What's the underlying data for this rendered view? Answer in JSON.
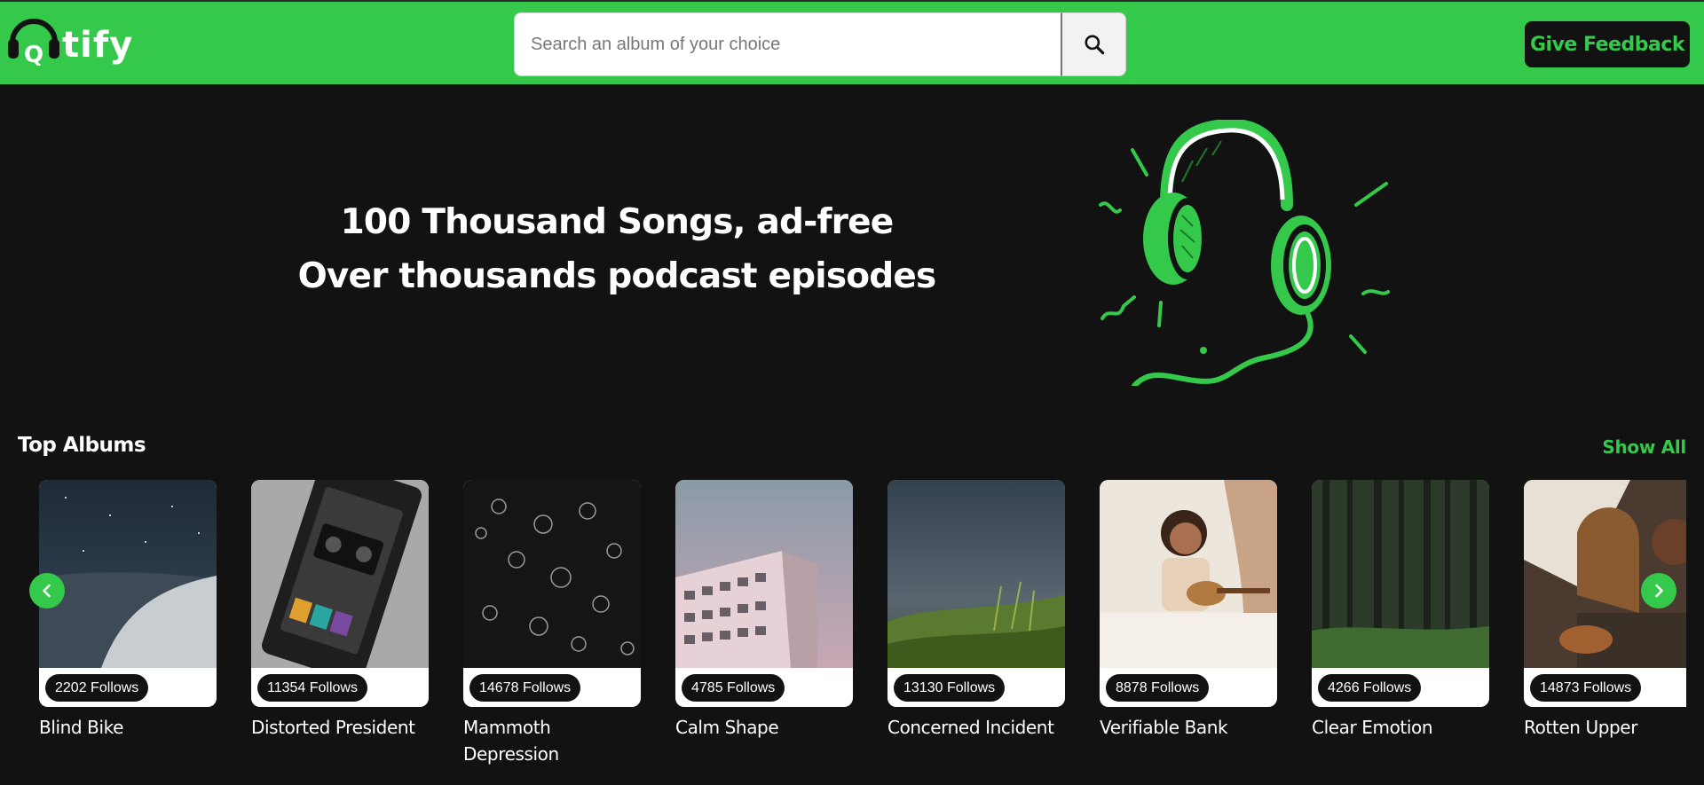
{
  "navbar": {
    "logo_text": "tify",
    "logo_letter": "Q",
    "search_placeholder": "Search an album of your choice",
    "search_icon": "search-icon",
    "feedback_label": "Give Feedback",
    "brand_color": "#34c94b"
  },
  "hero": {
    "line1": "100 Thousand Songs, ad-free",
    "line2": "Over thousands podcast episodes",
    "art_icon": "headphones-illustration"
  },
  "top_albums": {
    "title": "Top Albums",
    "show_all": "Show All",
    "prev_icon": "chevron-left-icon",
    "next_icon": "chevron-right-icon",
    "albums": [
      {
        "name": "Blind Bike",
        "follows": "2202 Follows"
      },
      {
        "name": "Distorted President",
        "follows": "11354 Follows"
      },
      {
        "name": "Mammoth Depression",
        "follows": "14678 Follows"
      },
      {
        "name": "Calm Shape",
        "follows": "4785 Follows"
      },
      {
        "name": "Concerned Incident",
        "follows": "13130 Follows"
      },
      {
        "name": "Verifiable Bank",
        "follows": "8878 Follows"
      },
      {
        "name": "Clear Emotion",
        "follows": "4266 Follows"
      },
      {
        "name": "Rotten Upper",
        "follows": "14873 Follows"
      }
    ]
  }
}
